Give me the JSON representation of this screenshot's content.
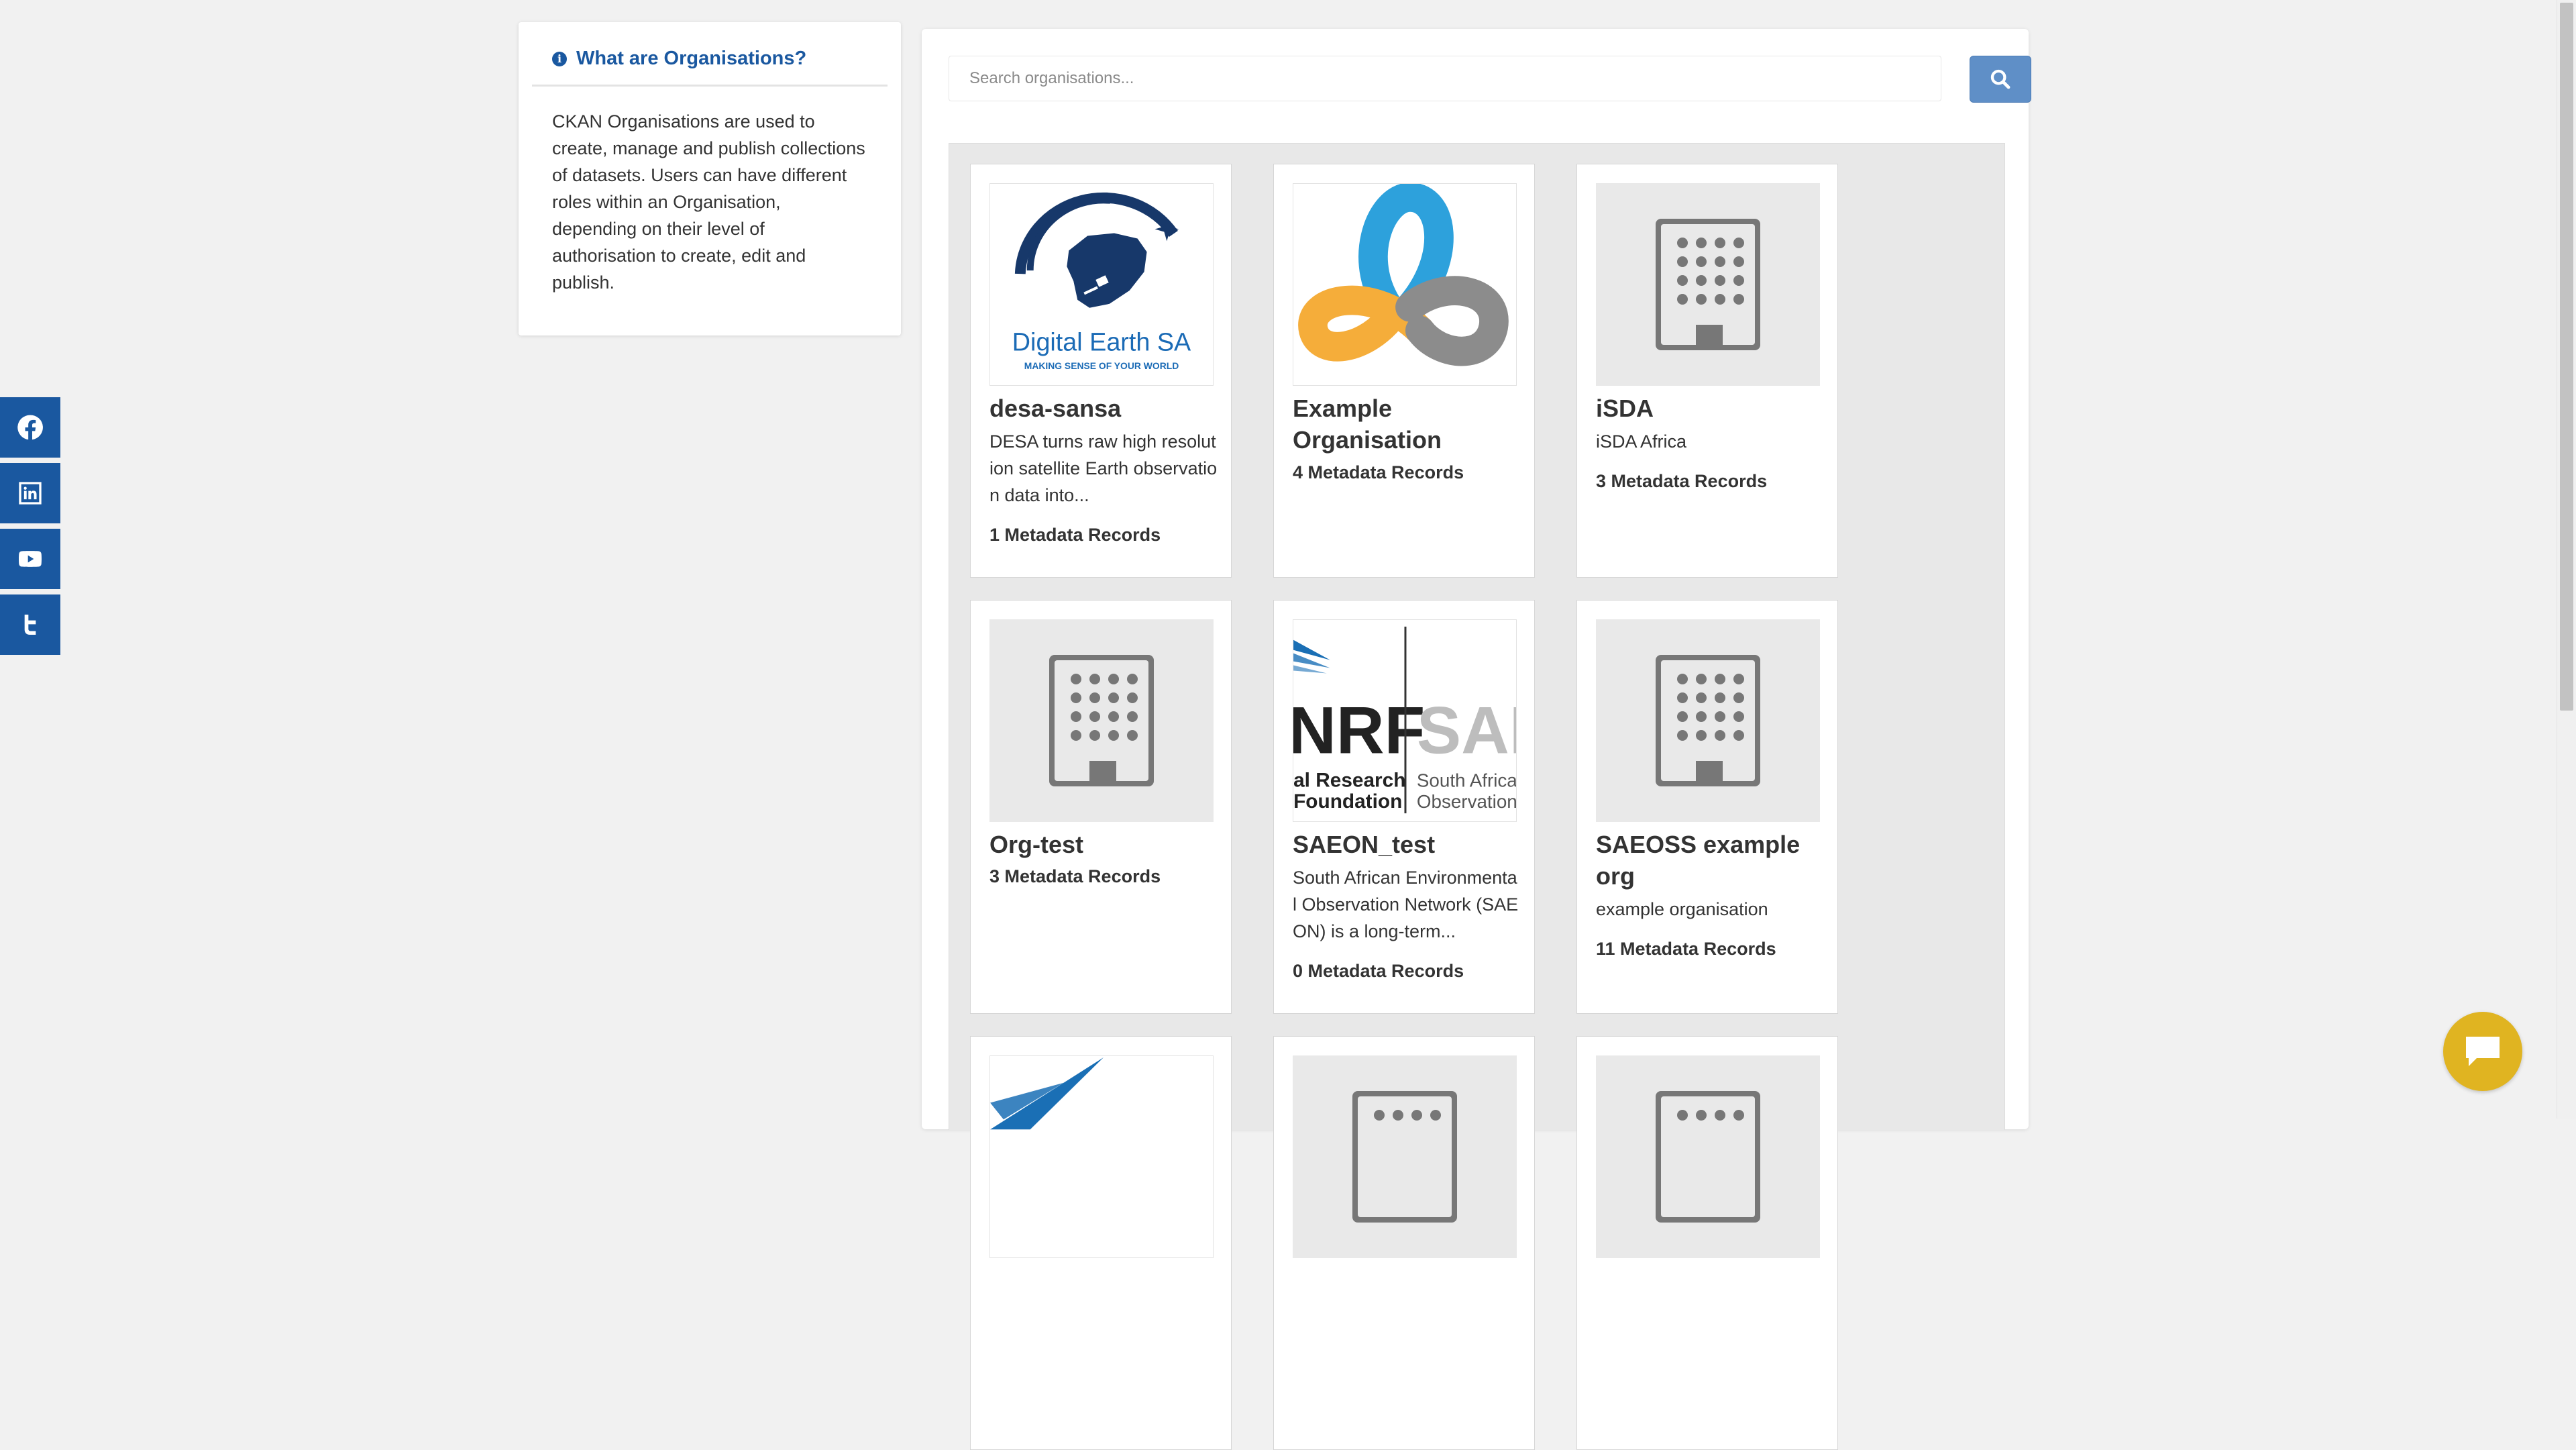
{
  "social": [
    {
      "name": "facebook-icon"
    },
    {
      "name": "linkedin-icon"
    },
    {
      "name": "youtube-icon"
    },
    {
      "name": "twitter-icon"
    }
  ],
  "info": {
    "title": "What are Organisations?",
    "body": "CKAN Organisations are used to create, manage and publish collections of datasets. Users can have different roles within an Organisation, depending on their level of authorisation to create, edit and publish."
  },
  "search": {
    "placeholder": "Search organisations..."
  },
  "brand": {
    "desa_logo_name": "Digital Earth SA",
    "desa_logo_tagline": "MAKING SENSE OF YOUR WORLD",
    "nrf_text": "NRF",
    "nrf_sub1": "al Research",
    "nrf_sub2": "Foundation",
    "saeon_text": "SAE",
    "saeon_sub1": "South Africa",
    "saeon_sub2": "Observation"
  },
  "orgs": [
    {
      "title": "desa-sansa",
      "description": "DESA turns raw high resolution satellite Earth observation data into...",
      "count": "1 Metadata Records"
    },
    {
      "title": "Example Organisation",
      "description": "",
      "count": "4 Metadata Records"
    },
    {
      "title": "iSDA",
      "description": "iSDA Africa",
      "count": "3 Metadata Records"
    },
    {
      "title": "Org-test",
      "description": "",
      "count": "3 Metadata Records"
    },
    {
      "title": "SAEON_test",
      "description": "South African Environmental Observation Network (SAEON) is a long-term...",
      "count": "0 Metadata Records"
    },
    {
      "title": "SAEOSS example org",
      "description": "example organisation",
      "count": "11 Metadata Records"
    }
  ],
  "colors": {
    "brand_blue": "#1a58a0",
    "search_button": "#5f8fc7",
    "chat_button": "#e0b421"
  }
}
